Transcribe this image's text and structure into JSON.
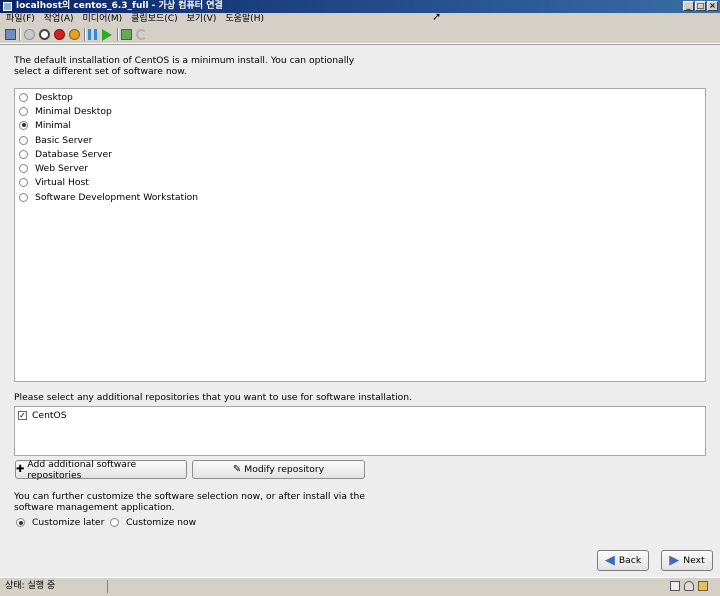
{
  "window": {
    "title": "localhost의 centos_6.3_full - 가상 컴퓨터 연결"
  },
  "menubar": [
    "파일(F)",
    "작업(A)",
    "미디어(M)",
    "클립보드(C)",
    "보기(V)",
    "도움말(H)"
  ],
  "toolbar": {
    "icons": [
      "ctrl-alt-del-icon",
      "start-icon",
      "turn-off-icon",
      "shutdown-icon",
      "save-state-icon",
      "pause-icon",
      "resume-icon",
      "snapshot-icon",
      "revert-icon"
    ]
  },
  "installer": {
    "intro": "The default installation of CentOS is a minimum install. You can optionally select a different set of software now.",
    "options": [
      {
        "label": "Desktop",
        "selected": false
      },
      {
        "label": "Minimal Desktop",
        "selected": false
      },
      {
        "label": "Minimal",
        "selected": true
      },
      {
        "label": "Basic Server",
        "selected": false
      },
      {
        "label": "Database Server",
        "selected": false
      },
      {
        "label": "Web Server",
        "selected": false
      },
      {
        "label": "Virtual Host",
        "selected": false
      },
      {
        "label": "Software Development Workstation",
        "selected": false
      }
    ],
    "repo_prompt": "Please select any additional repositories that you want to use for software installation.",
    "repos": [
      {
        "label": "CentOS",
        "checked": true
      }
    ],
    "add_repo_label": "Add additional software repositories",
    "modify_repo_label": "Modify repository",
    "further_text": "You can further customize the software selection now, or after install via the software management application.",
    "customize_later": "Customize later",
    "customize_now": "Customize now",
    "customize_selected": "later",
    "back_label": "Back",
    "next_label": "Next"
  },
  "statusbar": {
    "text": "상태: 실행 중"
  },
  "colors": {
    "titlebar": "#0a246a",
    "accent": "#3d6bb8"
  }
}
